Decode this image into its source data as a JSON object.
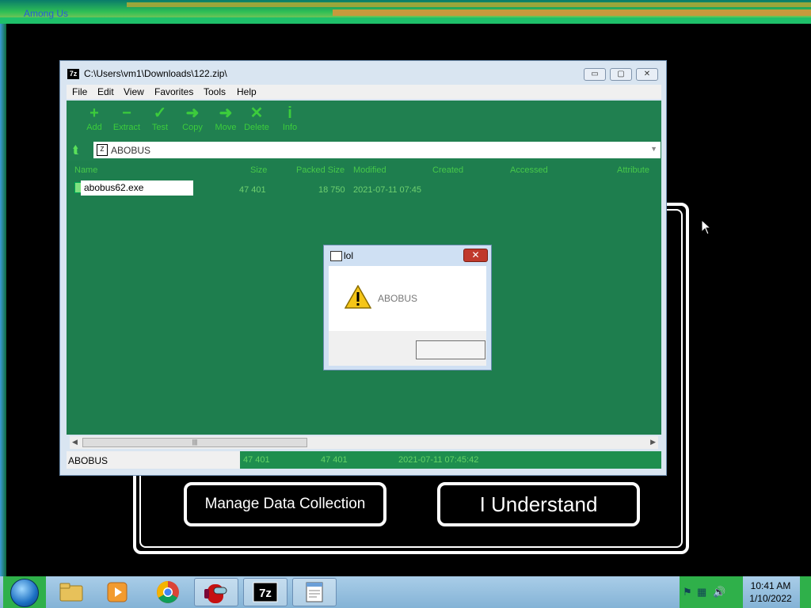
{
  "background": {
    "window_title": "Among Us",
    "buttons": {
      "manage": "Manage Data Collection",
      "understand": "I Understand"
    }
  },
  "zip_window": {
    "title": "C:\\Users\\vm1\\Downloads\\122.zip\\",
    "controls": {
      "minimize": "▭",
      "maximize": "▢",
      "close": "✕"
    },
    "menu": [
      "File",
      "Edit",
      "View",
      "Favorites",
      "Tools",
      "Help"
    ],
    "toolbar": [
      {
        "label": "Add",
        "icon": "+"
      },
      {
        "label": "Extract",
        "icon": "−"
      },
      {
        "label": "Test",
        "icon": "✓"
      },
      {
        "label": "Copy",
        "icon": "➜"
      },
      {
        "label": "Move",
        "icon": "➜"
      },
      {
        "label": "Delete",
        "icon": "✕"
      },
      {
        "label": "Info",
        "icon": "i"
      }
    ],
    "address": "ABOBUS",
    "columns": [
      "Name",
      "Size",
      "Packed Size",
      "Modified",
      "Created",
      "Accessed",
      "Attribute"
    ],
    "rows": [
      {
        "name": "abobus62.exe",
        "size": "47 401",
        "packed": "18 750",
        "modified": "2021-07-11 07:45"
      }
    ],
    "status": {
      "text": "ABOBUS",
      "size": "47 401",
      "packed": "47 401",
      "modified": "2021-07-11 07:45:42"
    }
  },
  "dialog": {
    "title": "lol",
    "close": "✕",
    "message": "ABOBUS",
    "ok_label": ""
  },
  "taskbar": {
    "apps": [
      "explorer-icon",
      "media-player-icon",
      "chrome-icon",
      "among-us-icon",
      "7zip-icon",
      "notepad-icon"
    ],
    "time": "10:41 AM",
    "date": "1/10/2022"
  }
}
